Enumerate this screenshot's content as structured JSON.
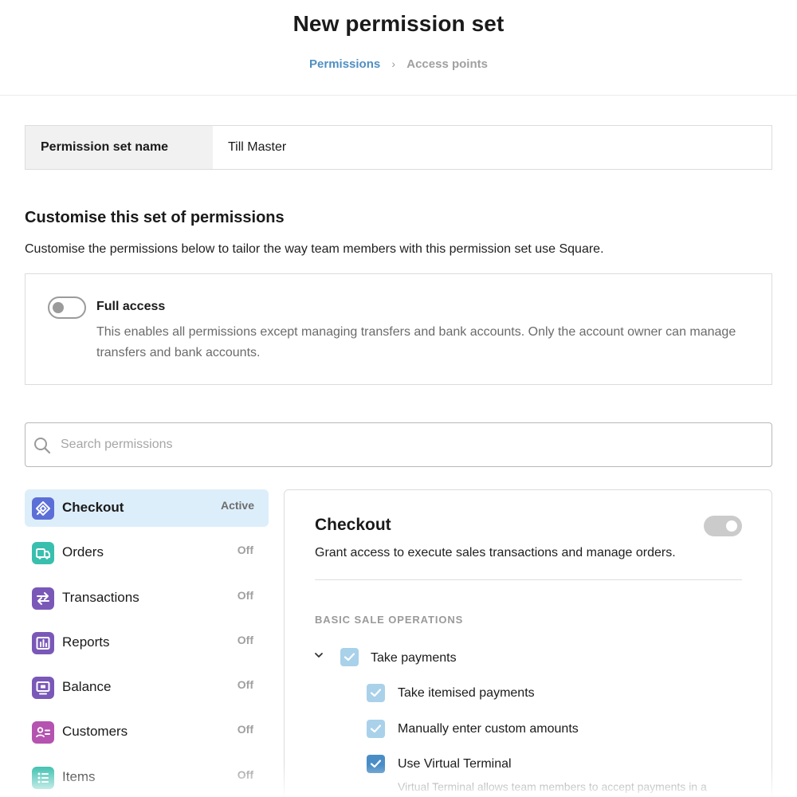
{
  "header": {
    "title": "New permission set",
    "breadcrumb": {
      "step1": "Permissions",
      "separator": "›",
      "step2": "Access points"
    }
  },
  "name_field": {
    "label": "Permission set name",
    "value": "Till Master"
  },
  "customise": {
    "title": "Customise this set of permissions",
    "description": "Customise the permissions below to tailor the way team members with this permission set use Square."
  },
  "full_access": {
    "title": "Full access",
    "description": "This enables all permissions except managing transfers and bank accounts. Only the account owner can manage transfers and bank accounts.",
    "enabled": false
  },
  "search": {
    "placeholder": "Search permissions",
    "value": ""
  },
  "sidebar": {
    "items": [
      {
        "label": "Checkout",
        "status": "Active",
        "icon": "checkout-icon",
        "color": "#5b6fd6"
      },
      {
        "label": "Orders",
        "status": "Off",
        "icon": "orders-icon",
        "color": "#39bfae"
      },
      {
        "label": "Transactions",
        "status": "Off",
        "icon": "transactions-icon",
        "color": "#7a58b8"
      },
      {
        "label": "Reports",
        "status": "Off",
        "icon": "reports-icon",
        "color": "#7a58b8"
      },
      {
        "label": "Balance",
        "status": "Off",
        "icon": "balance-icon",
        "color": "#7a58b8"
      },
      {
        "label": "Customers",
        "status": "Off",
        "icon": "customers-icon",
        "color": "#b553b0"
      },
      {
        "label": "Items",
        "status": "Off",
        "icon": "items-icon",
        "color": "#39bfae"
      }
    ]
  },
  "detail": {
    "title": "Checkout",
    "description": "Grant access to execute sales transactions and manage orders.",
    "group_label": "BASIC SALE OPERATIONS",
    "permissions": {
      "take_payments": "Take payments",
      "take_itemised": "Take itemised payments",
      "manual_amounts": "Manually enter custom amounts",
      "virtual_terminal": "Use Virtual Terminal",
      "virtual_terminal_note": "Virtual Terminal allows team members to accept payments in a"
    }
  },
  "colors": {
    "accent_link": "#4f8fc2",
    "active_bg": "#ddeefb",
    "checkbox_light": "#a9d1ea",
    "checkbox_strong": "#4a8dc6"
  }
}
